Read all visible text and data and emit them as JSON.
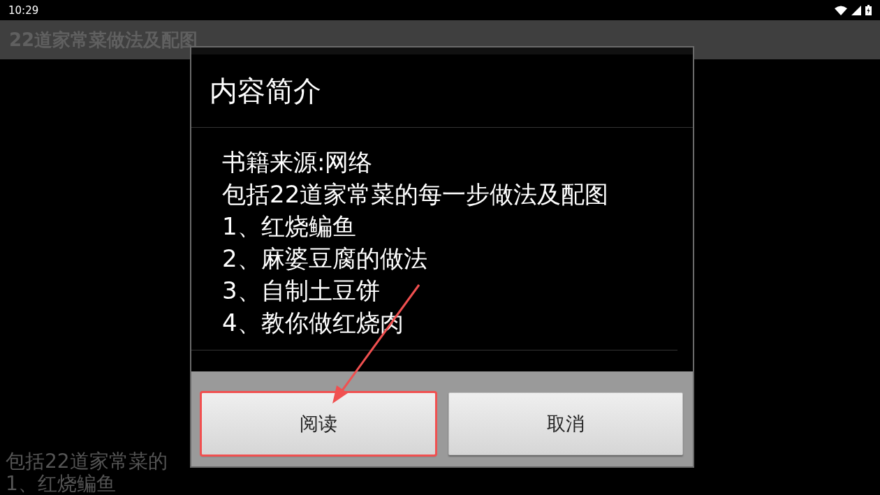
{
  "status_bar": {
    "time": "10:29"
  },
  "app_bar": {
    "title": "22道家常菜做法及配图"
  },
  "background_text": [
    "包括22道家常菜的",
    "1、红烧鳊鱼"
  ],
  "dialog": {
    "title": "内容简介",
    "lines": [
      "书籍来源:网络",
      "包括22道家常菜的每一步做法及配图",
      "1、红烧鳊鱼",
      "2、麻婆豆腐的做法",
      "3、自制土豆饼",
      "4、教你做红烧肉"
    ],
    "buttons": [
      {
        "label": "阅读",
        "highlighted": true
      },
      {
        "label": "取消",
        "highlighted": false
      }
    ]
  },
  "annotation_arrow": true
}
